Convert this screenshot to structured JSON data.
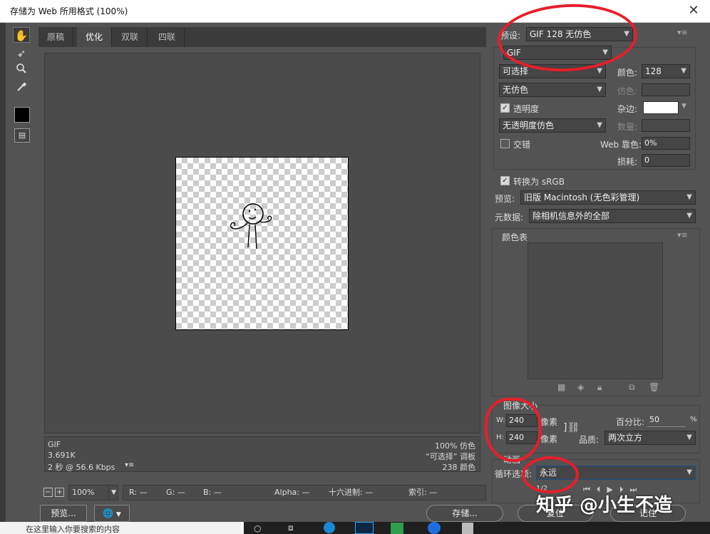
{
  "window": {
    "title": "存储为 Web 所用格式 (100%)",
    "close_glyph": "✕"
  },
  "tabs": [
    "原稿",
    "优化",
    "双联",
    "四联"
  ],
  "info": {
    "format": "GIF",
    "size": "3.691K",
    "time": "2 秒 @ 56.6 Kbps",
    "menu_glyph": "▾≡",
    "dither": "100% 仿色",
    "palette": "“可选择” 调板",
    "colors": "238 颜色"
  },
  "status": {
    "zoom": "100%",
    "r": "R: —",
    "g": "G: —",
    "b": "B: —",
    "alpha": "Alpha: —",
    "hex": "十六进制: —",
    "index": "索引: —"
  },
  "bottom": {
    "preview": "预览...",
    "save": "存储...",
    "reset": "复位",
    "done": "记住"
  },
  "right": {
    "preset_label": "预设:",
    "preset_value": "GIF 128 无仿色",
    "format_value": "GIF",
    "reduction": "可选择",
    "colors_label": "颜色:",
    "colors_value": "128",
    "dither_algo": "无仿色",
    "dither_label": "仿色:",
    "transparency_label": "透明度",
    "matte_label": "杂边:",
    "trans_dither": "无透明度仿色",
    "amount_label": "数量:",
    "interlaced_label": "交错",
    "websnap_label": "Web 靠色:",
    "websnap_value": "0%",
    "lossy_label": "损耗:",
    "lossy_value": "0",
    "srgb_label": "转换为 sRGB",
    "preview_label": "预览:",
    "preview_value": "旧版 Macintosh (无色彩管理)",
    "metadata_label": "元数据:",
    "metadata_value": "除相机信息外的全部",
    "colortable_label": "颜色表",
    "imagesize_label": "图像大小",
    "w_label": "W:",
    "w_value": "240",
    "h_label": "H:",
    "h_value": "240",
    "px": "像素",
    "percent_label": "百分比:",
    "percent_value": "50",
    "percent_unit": "%",
    "quality_label": "品质:",
    "quality_value": "两次立方",
    "anim_label": "动画",
    "loop_label": "循环选项:",
    "loop_value": "永远",
    "frame_counter": "1/2"
  },
  "taskbar": {
    "search_placeholder": "在这里输入你要搜索的内容"
  },
  "watermark": "知乎 @小生不造",
  "colors": {
    "annotation": "#e61e2b",
    "panel": "#535353"
  }
}
